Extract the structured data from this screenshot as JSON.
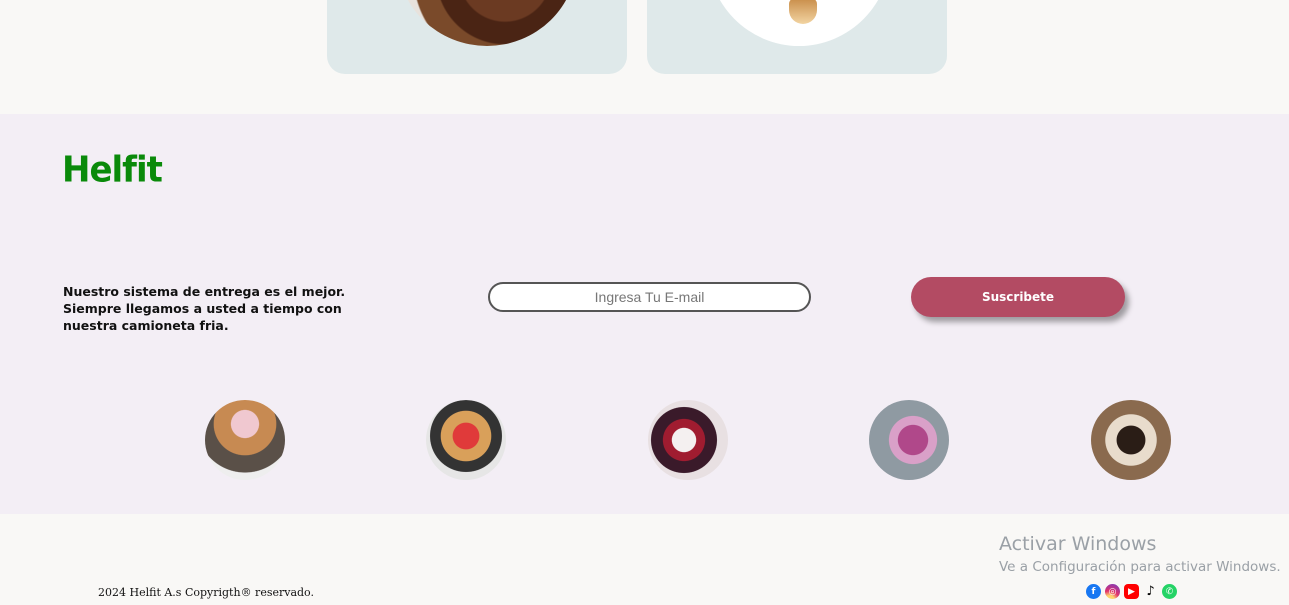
{
  "brand": {
    "logo": "Helfit",
    "logo_color": "#0a8a0a"
  },
  "newsletter": {
    "description": "Nuestro sistema de entrega es el mejor. Siempre llegamos a usted a tiempo con nuestra camioneta fria.",
    "email_placeholder": "Ingresa Tu E-mail",
    "subscribe_label": "Suscribete",
    "subscribe_color": "#b34b63",
    "thumbnails": [
      {
        "icon": "ice-cream-cones-image"
      },
      {
        "icon": "strawberry-dessert-image"
      },
      {
        "icon": "berry-dessert-image"
      },
      {
        "icon": "popsicles-image"
      },
      {
        "icon": "chocolate-ice-cream-bars-image"
      }
    ]
  },
  "footer": {
    "copyright": "2024 Helfit A.s Copyrigth® reservado.",
    "windows_title": "Activar Windows",
    "windows_subtitle": "Ve a Configuración para activar Windows.",
    "socials": [
      {
        "icon": "facebook-icon",
        "glyph": "f"
      },
      {
        "icon": "instagram-icon",
        "glyph": "◎"
      },
      {
        "icon": "youtube-icon",
        "glyph": "▶"
      },
      {
        "icon": "tiktok-icon",
        "glyph": "♪"
      },
      {
        "icon": "whatsapp-icon",
        "glyph": "✆"
      }
    ]
  }
}
